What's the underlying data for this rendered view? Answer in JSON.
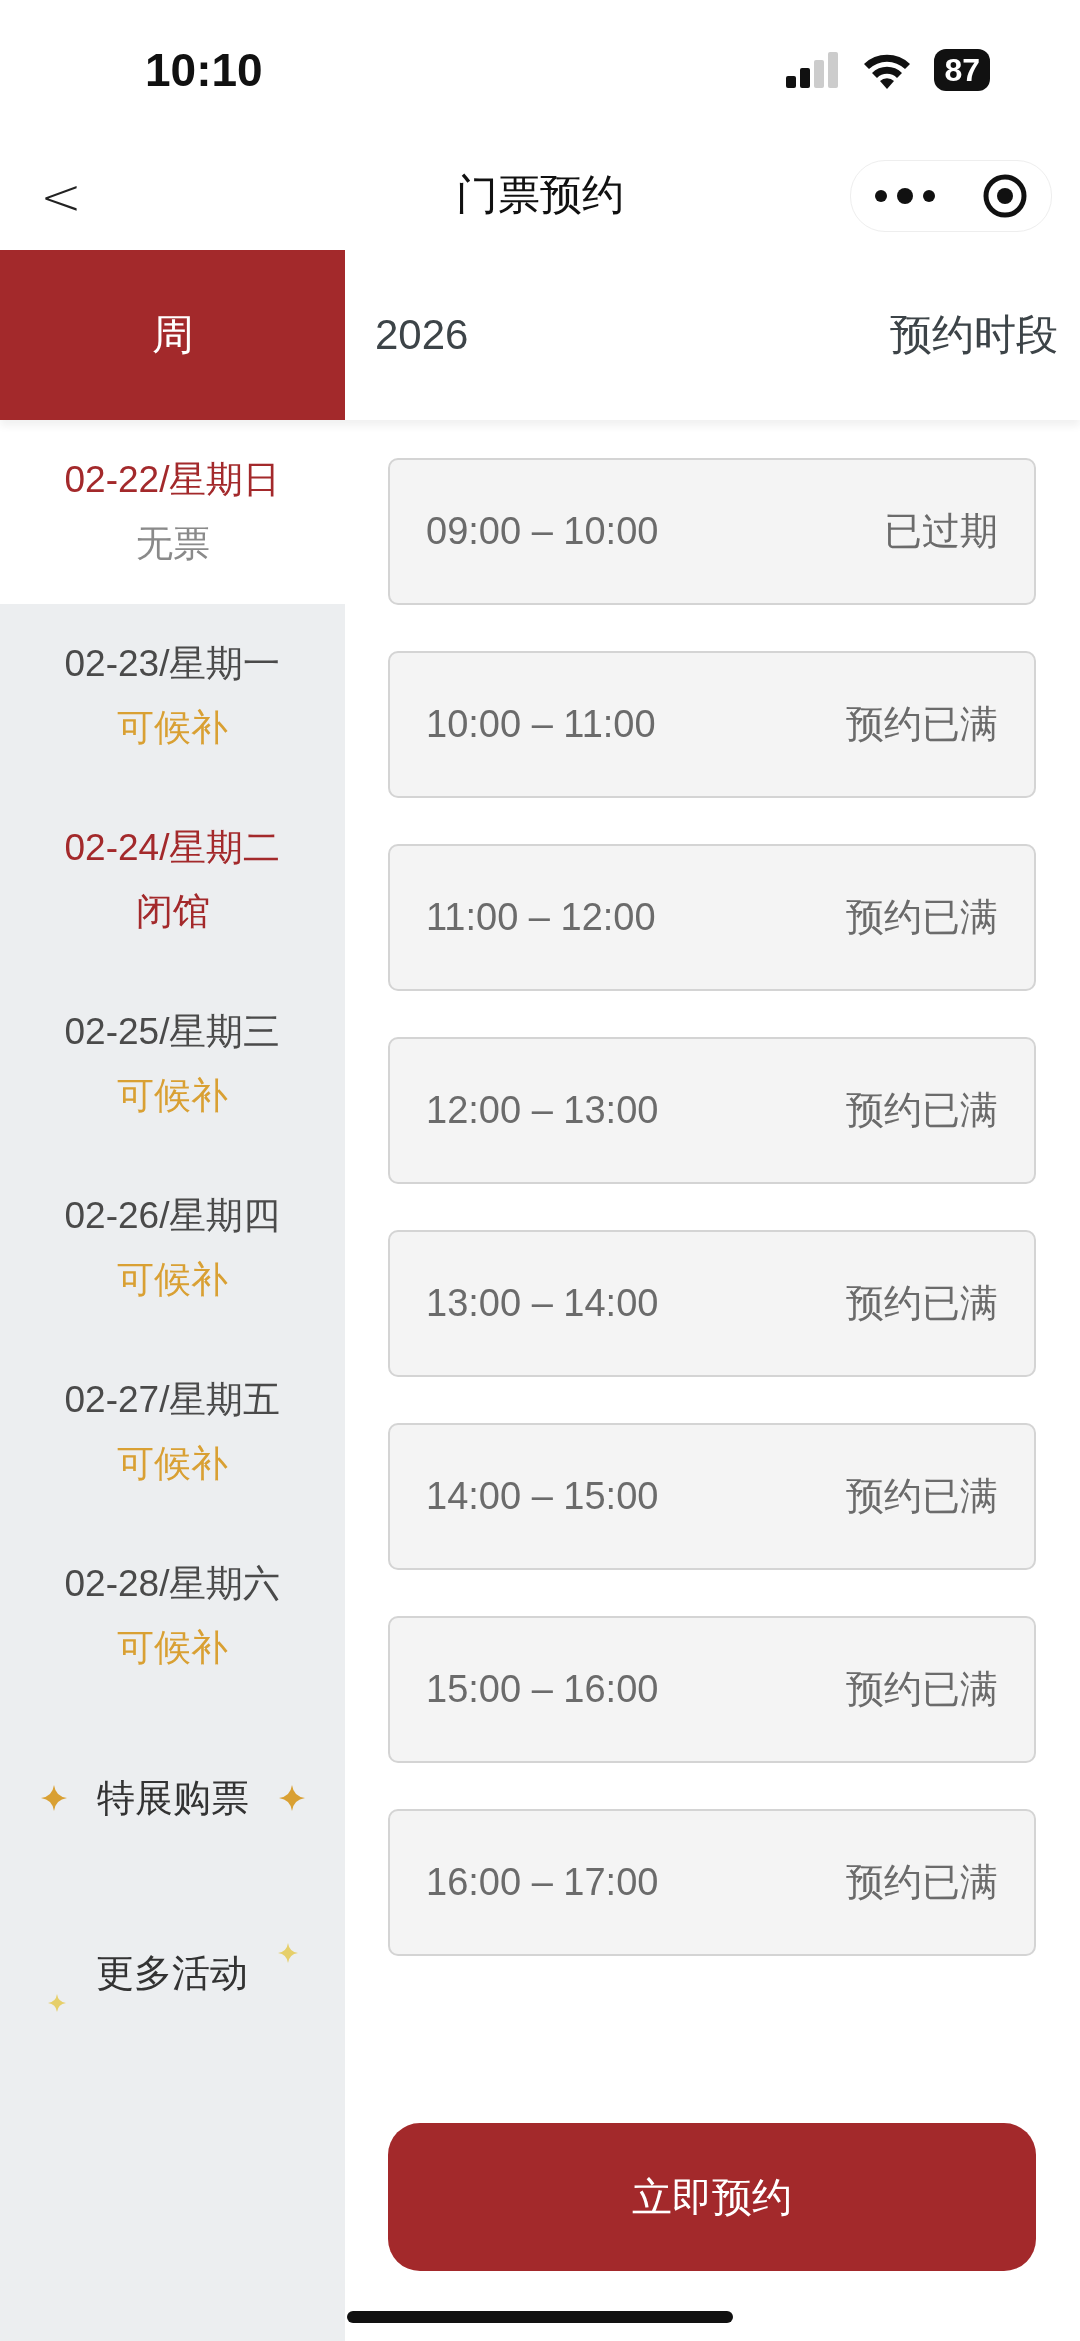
{
  "status_bar": {
    "time": "10:10",
    "battery": "87"
  },
  "nav": {
    "back": "<",
    "title": "门票预约"
  },
  "header": {
    "week_label": "周",
    "year": "2026",
    "title": "预约时段"
  },
  "days": [
    {
      "date": "02-22/星期日",
      "status": "无票",
      "kind": "none",
      "selected": true
    },
    {
      "date": "02-23/星期一",
      "status": "可候补",
      "kind": "waitlist",
      "selected": false
    },
    {
      "date": "02-24/星期二",
      "status": "闭馆",
      "kind": "closed",
      "selected": false
    },
    {
      "date": "02-25/星期三",
      "status": "可候补",
      "kind": "waitlist",
      "selected": false
    },
    {
      "date": "02-26/星期四",
      "status": "可候补",
      "kind": "waitlist",
      "selected": false
    },
    {
      "date": "02-27/星期五",
      "status": "可候补",
      "kind": "waitlist",
      "selected": false
    },
    {
      "date": "02-28/星期六",
      "status": "可候补",
      "kind": "waitlist",
      "selected": false
    }
  ],
  "special_tickets": "特展购票",
  "more_activities": "更多活动",
  "slots": [
    {
      "time": "09:00 – 10:00",
      "status": "已过期"
    },
    {
      "time": "10:00 – 11:00",
      "status": "预约已满"
    },
    {
      "time": "11:00 – 12:00",
      "status": "预约已满"
    },
    {
      "time": "12:00 – 13:00",
      "status": "预约已满"
    },
    {
      "time": "13:00 – 14:00",
      "status": "预约已满"
    },
    {
      "time": "14:00 – 15:00",
      "status": "预约已满"
    },
    {
      "time": "15:00 – 16:00",
      "status": "预约已满"
    },
    {
      "time": "16:00 – 17:00",
      "status": "预约已满"
    }
  ],
  "submit": "立即预约"
}
